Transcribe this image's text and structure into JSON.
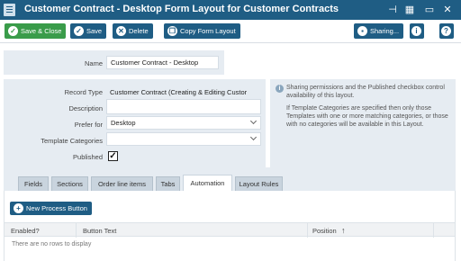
{
  "window": {
    "title": "Customer Contract - Desktop Form Layout for Customer Contracts",
    "pin_glyph": "⊣",
    "tile_glyph": "▦",
    "minimize_glyph": "▭",
    "close_glyph": "✕"
  },
  "toolbar": {
    "save_close_label": "Save & Close",
    "save_label": "Save",
    "delete_label": "Delete",
    "copy_label": "Copy Form Layout",
    "sharing_label": "Sharing...",
    "info_glyph": "i",
    "help_glyph": "?"
  },
  "form": {
    "name_label": "Name",
    "name_value": "Customer Contract - Desktop",
    "record_type_label": "Record Type",
    "record_type_value": "Customer Contract (Creating & Editing Custor",
    "description_label": "Description",
    "description_value": "",
    "prefer_for_label": "Prefer for",
    "prefer_for_value": "Desktop",
    "template_categories_label": "Template Categories",
    "template_categories_value": "",
    "published_label": "Published",
    "published_checked": true
  },
  "info": {
    "paragraph1": "Sharing permissions and the Published checkbox control availability of this layout.",
    "paragraph2": "If Template Categories are specified then only those Templates with one or more matching categories, or those with no categories will be available in this Layout."
  },
  "tabs": [
    {
      "label": "Fields",
      "active": false
    },
    {
      "label": "Sections",
      "active": false
    },
    {
      "label": "Order line items",
      "active": false
    },
    {
      "label": "Tabs",
      "active": false
    },
    {
      "label": "Automation",
      "active": true
    },
    {
      "label": "Layout Rules",
      "active": false
    }
  ],
  "automation": {
    "new_process_label": "New Process Button",
    "columns": [
      "Enabled?",
      "Button Text",
      "Position"
    ],
    "sort_glyph": "↑",
    "empty_message": "There are no rows to display"
  },
  "colors": {
    "titlebar": "#1f5d84",
    "save_green": "#3a9c4a",
    "panel_bg": "#e6ecf2"
  }
}
